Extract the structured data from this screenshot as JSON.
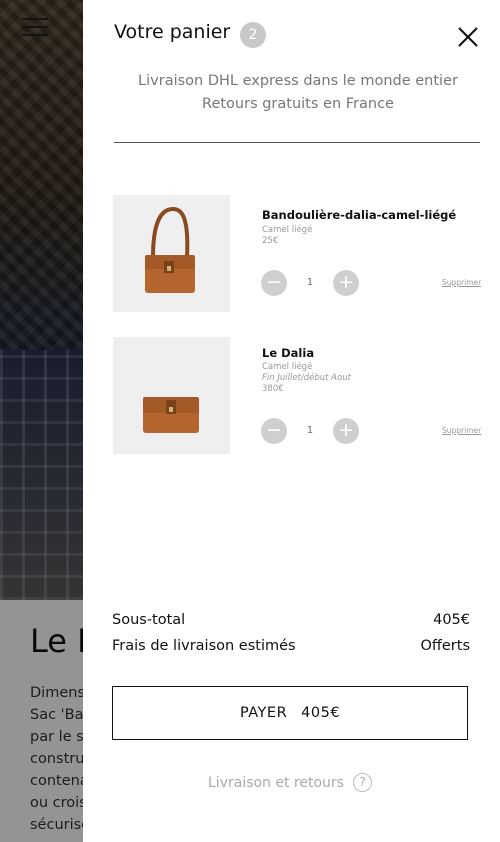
{
  "background": {
    "title": "Le D",
    "description_lines": [
      "Dimens",
      "Sac 'Bag",
      "par le st",
      "constru",
      "contena",
      "ou crois",
      "sécurisé"
    ]
  },
  "cart": {
    "title": "Votre panier",
    "count": "2",
    "shipping_line1": "Livraison DHL express dans le monde entier",
    "shipping_line2": "Retours gratuits en France",
    "items": [
      {
        "name": "Bandoulière-dalia-camel-liégé",
        "color": "Camel liégé",
        "note": "",
        "price": "25€",
        "quantity": "1",
        "remove_label": "Supprimer",
        "image": "brown-shoulder-bag"
      },
      {
        "name": "Le Dalia",
        "color": "Camel liégé",
        "note": "Fin Juillet/début Aout",
        "price": "380€",
        "quantity": "1",
        "remove_label": "Supprimer",
        "image": "brown-flap-bag"
      }
    ],
    "subtotal_label": "Sous-total",
    "subtotal_value": "405€",
    "delivery_label": "Frais de livraison estimés",
    "delivery_value": "Offerts",
    "pay_label": "PAYER",
    "pay_amount": "405€",
    "returns_label": "Livraison et retours",
    "help_glyph": "?"
  },
  "colors": {
    "bag": "#b5652e",
    "bag_dark": "#8a4a20",
    "count_badge": "#c8c8c8"
  }
}
